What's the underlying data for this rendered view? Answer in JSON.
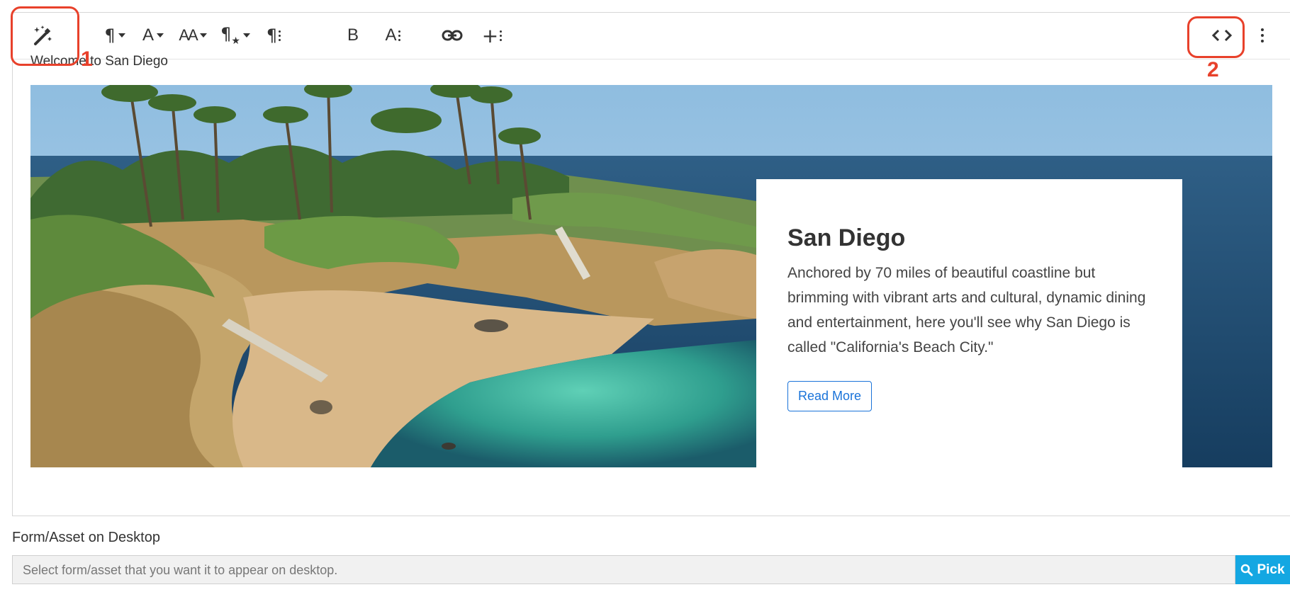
{
  "toolbar": {
    "magic_icon": "magic-wand-icon",
    "paragraph_icon": "pilcrow-icon",
    "font_label": "A",
    "font_size_label": "AA",
    "paragraph_style_icon": "paragraph-star-icon",
    "paragraph_more_icon": "paragraph-more-icon",
    "bold_label": "B",
    "text_more_label": "A",
    "link_icon": "link-icon",
    "insert_icon": "plus-icon",
    "code_view_icon": "code-icon",
    "more_icon": "vertical-ellipsis-icon"
  },
  "annotations": {
    "first": "1",
    "second": "2",
    "color": "#e8412b"
  },
  "content": {
    "welcome_text": "Welcome to San Diego",
    "hero_image": "coastal-beach-photo",
    "card": {
      "title": "San Diego",
      "body": "Anchored by 70 miles of beautiful coastline but brimming with vibrant arts and cultural, dynamic dining and entertainment, here you'll see why San Diego is called \"California's Beach City.\"",
      "button_label": "Read More"
    }
  },
  "form": {
    "label": "Form/Asset on Desktop",
    "placeholder": "Select form/asset that you want it to appear on desktop.",
    "pick_label": "Pick",
    "accent": "#14a7e2"
  }
}
